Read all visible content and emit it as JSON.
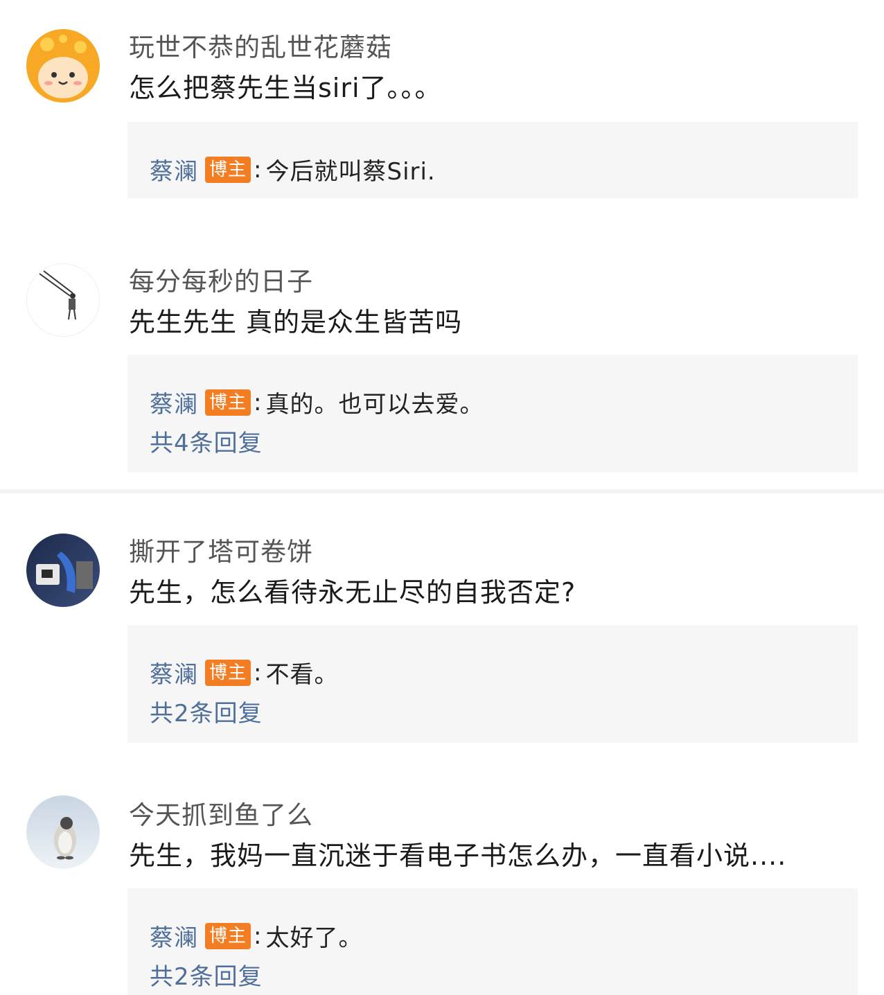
{
  "comments": [
    {
      "username": "玩世不恭的乱世花蘑菇",
      "text": "怎么把蔡先生当siri了。。。",
      "reply": {
        "author": "蔡澜",
        "badge": "博主",
        "colon": ":",
        "text": "今后就叫蔡Siri.",
        "count": ""
      }
    },
    {
      "username": "每分每秒的日子",
      "text": "先生先生 真的是众生皆苦吗",
      "reply": {
        "author": "蔡澜",
        "badge": "博主",
        "colon": ":",
        "text": "真的。也可以去爱。",
        "count": "共4条回复"
      }
    },
    {
      "username": "撕开了塔可卷饼",
      "text": "先生，怎么看待永无止尽的自我否定?",
      "reply": {
        "author": "蔡澜",
        "badge": "博主",
        "colon": ":",
        "text": "不看。",
        "count": "共2条回复"
      }
    },
    {
      "username": "今天抓到鱼了么",
      "text": "先生，我妈一直沉迷于看电子书怎么办，一直看小说....",
      "reply": {
        "author": "蔡澜",
        "badge": "博主",
        "colon": ":",
        "text": "太好了。",
        "count": "共2条回复"
      }
    }
  ],
  "colors": {
    "reply_author": "#4f6f9a",
    "badge_bg": "#f37d22",
    "reply_bg": "#f6f6f6",
    "username": "#555555",
    "text": "#1a1a1a"
  },
  "icons": {
    "avatar_1": "mushroom-avatar-icon",
    "avatar_2": "stick-figure-avatar-icon",
    "avatar_3": "photo-avatar-icon",
    "avatar_4": "penguin-avatar-icon"
  }
}
